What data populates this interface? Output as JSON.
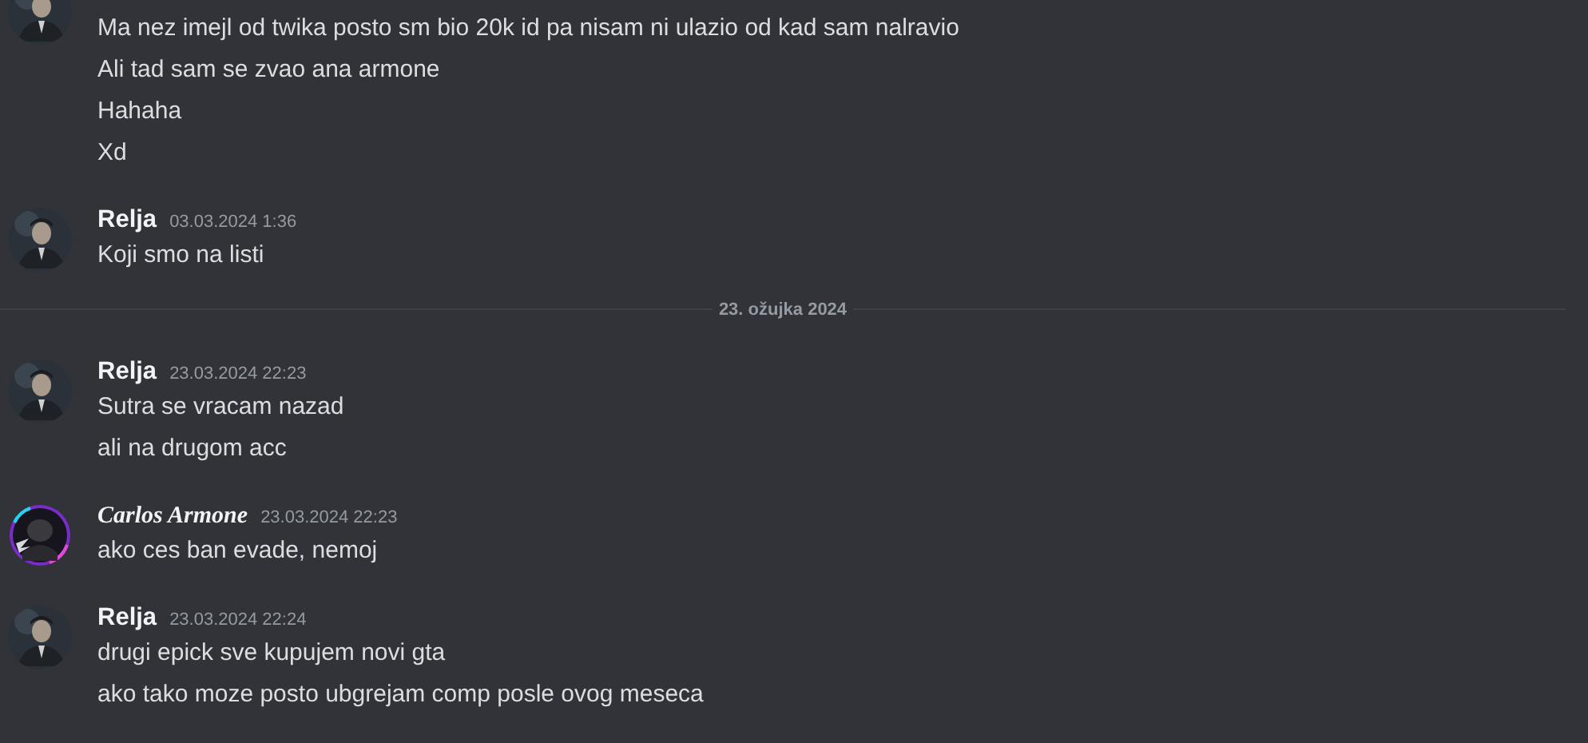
{
  "feed": [
    {
      "kind": "group",
      "avatar": {
        "kind": "picture"
      },
      "messages": [
        "Ma nez imejl od twika posto sm bio 20k id pa nisam ni ulazio od kad sam nalravio",
        "Ali tad sam se zvao ana armone",
        "Hahaha",
        "Xd"
      ]
    },
    {
      "kind": "group",
      "avatar": {
        "kind": "picture"
      },
      "author": "Relja",
      "timestamp": "03.03.2024 1:36",
      "messages": [
        "Koji smo na listi"
      ]
    },
    {
      "kind": "divider",
      "label": "23. ožujka 2024"
    },
    {
      "kind": "group",
      "avatar": {
        "kind": "picture"
      },
      "author": "Relja",
      "timestamp": "23.03.2024 22:23",
      "messages": [
        "Sutra se vracam nazad",
        "ali na drugom acc"
      ]
    },
    {
      "kind": "group",
      "avatar": {
        "kind": "picture",
        "decoration": true
      },
      "author": "Carlos Armone",
      "fancy_name": true,
      "timestamp": "23.03.2024 22:23",
      "messages": [
        "ako ces ban evade, nemoj"
      ]
    },
    {
      "kind": "group",
      "avatar": {
        "kind": "picture"
      },
      "author": "Relja",
      "timestamp": "23.03.2024 22:24",
      "messages": [
        "drugi epick sve kupujem novi gta",
        "ako tako moze posto ubgrejam comp posle ovog meseca"
      ]
    }
  ]
}
